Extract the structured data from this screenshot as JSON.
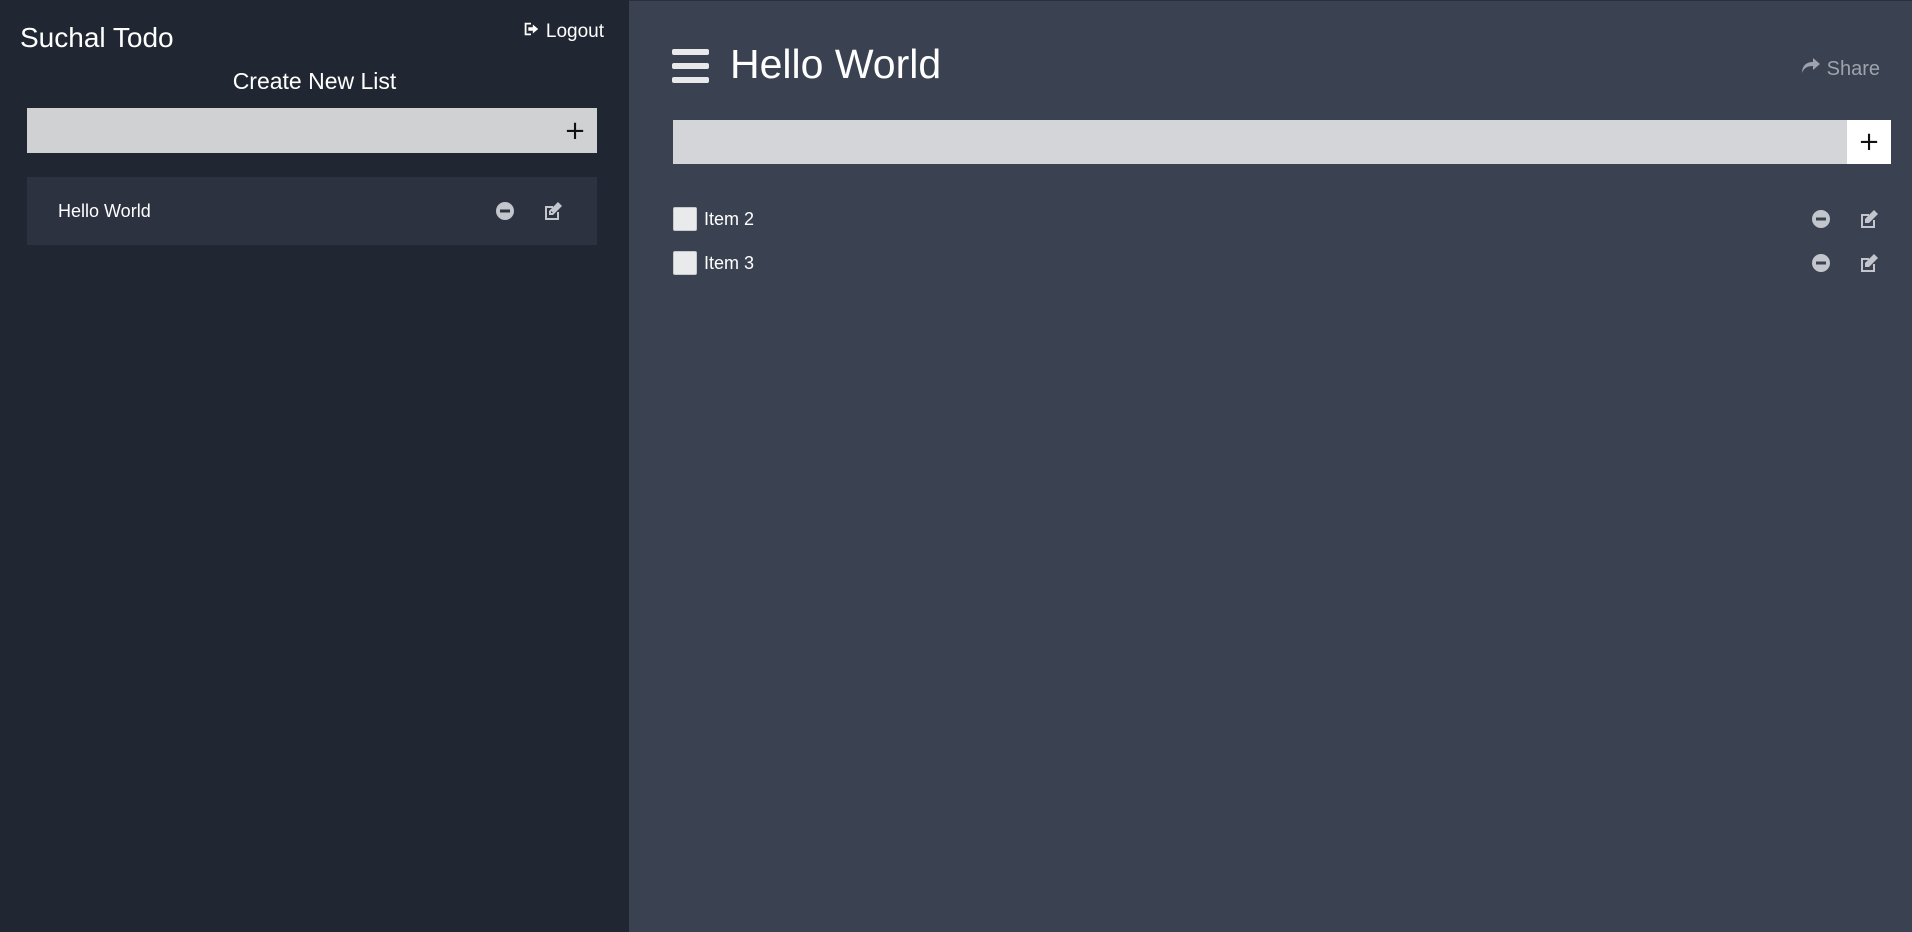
{
  "sidebar": {
    "app_title": "Suchal Todo",
    "logout_label": "Logout",
    "create_title": "Create New List",
    "new_list": {
      "placeholder": "",
      "value": "",
      "add_label": "+"
    },
    "lists": [
      {
        "name": "Hello World"
      }
    ]
  },
  "main": {
    "title": "Hello World",
    "share_label": "Share",
    "new_item": {
      "placeholder": "",
      "value": "",
      "add_label": "+"
    },
    "items": [
      {
        "label": "Item 2",
        "checked": false
      },
      {
        "label": "Item 3",
        "checked": false
      }
    ]
  },
  "colors": {
    "sidebar_bg": "#212732",
    "main_bg": "#3a4150",
    "list_card_bg": "#2c3240",
    "icon_gray": "#c3c6cc",
    "share_gray": "#9ea3ad"
  },
  "icons": {
    "logout": "sign-out-icon",
    "remove": "minus-circle-icon",
    "edit": "edit-icon",
    "menu": "hamburger-menu-icon",
    "share": "share-arrow-icon"
  }
}
